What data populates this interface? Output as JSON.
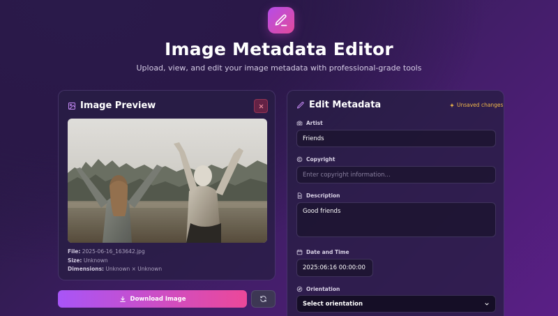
{
  "header": {
    "logo_icon": "pencil-icon",
    "title": "Image Metadata Editor",
    "subtitle": "Upload, view, and edit your image metadata with professional-grade tools"
  },
  "preview_panel": {
    "title": "Image Preview",
    "title_icon": "image-icon",
    "close_icon": "close-icon",
    "file_label": "File:",
    "file_value": "2025-06-16_163642.jpg",
    "size_label": "Size:",
    "size_value": "Unknown",
    "dimensions_label": "Dimensions:",
    "dimensions_value": "Unknown × Unknown"
  },
  "actions": {
    "download_label": "Download Image",
    "download_icon": "download-icon",
    "reset_icon": "refresh-icon"
  },
  "metadata_panel": {
    "title": "Edit Metadata",
    "title_icon": "pencil-icon",
    "unsaved_text": "Unsaved changes",
    "unsaved_icon": "sparkle-icon",
    "fields": {
      "artist": {
        "label": "Artist",
        "icon": "camera-icon",
        "value": "Friends"
      },
      "copyright": {
        "label": "Copyright",
        "icon": "copyright-icon",
        "placeholder": "Enter copyright information..."
      },
      "description": {
        "label": "Description",
        "icon": "document-icon",
        "value": "Good friends"
      },
      "datetime": {
        "label": "Date and Time",
        "icon": "calendar-icon",
        "value": "2025:06:16 00:00:00"
      },
      "orientation": {
        "label": "Orientation",
        "icon": "compass-icon",
        "value": "Select orientation"
      }
    }
  },
  "colors": {
    "accent_start": "#a855f7",
    "accent_end": "#ec4899",
    "warning": "#f2b94a"
  }
}
